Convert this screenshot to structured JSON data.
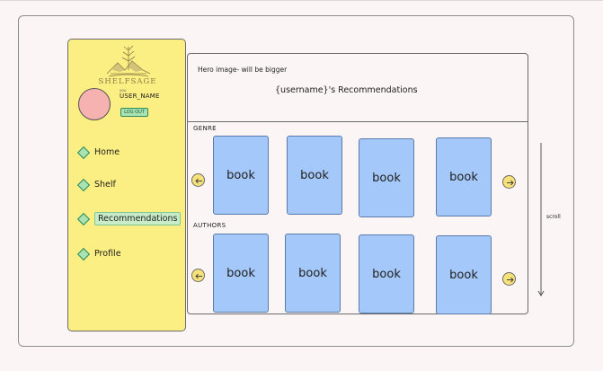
{
  "brand": {
    "name": "SHELFSAGE",
    "logo_icon": "mountain-logo-icon"
  },
  "user": {
    "small_label": "you",
    "name": "USER_NAME",
    "logout_label": "LOG OUT"
  },
  "nav": {
    "items": [
      {
        "label": "Home",
        "icon": "diamond-icon",
        "active": false
      },
      {
        "label": "Shelf",
        "icon": "diamond-icon",
        "active": false
      },
      {
        "label": "Recommendations",
        "icon": "diamond-icon",
        "active": true
      },
      {
        "label": "Profile",
        "icon": "diamond-icon",
        "active": false
      }
    ]
  },
  "hero": {
    "note": "Hero image- will be bigger",
    "title": "{username}'s Recommendations"
  },
  "sections": {
    "genre": {
      "label": "GENRE",
      "books": [
        "book",
        "book",
        "book",
        "book"
      ]
    },
    "authors": {
      "label": "AUTHORS",
      "books": [
        "book",
        "book",
        "book",
        "book"
      ]
    }
  },
  "scroll": {
    "label": "scroll"
  },
  "colors": {
    "sidebar": "#fbee82",
    "book": "#a5c8fa",
    "avatar": "#f6b1b1",
    "nav_diamond": "#a9e3b4",
    "arrow_button": "#f7e27a"
  }
}
